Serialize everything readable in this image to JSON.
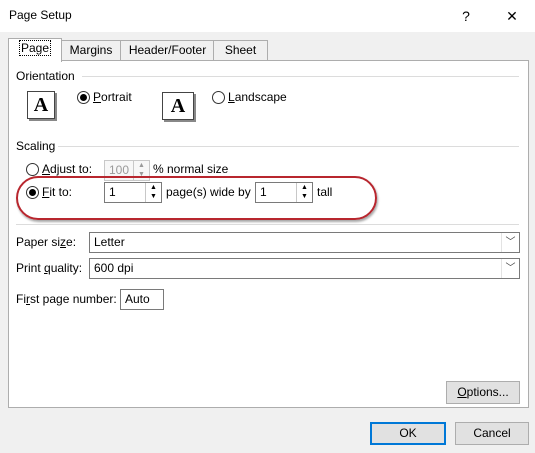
{
  "window": {
    "title": "Page Setup",
    "help_glyph": "?",
    "close_glyph": "✕"
  },
  "tabs": [
    {
      "label": "Page",
      "active": true
    },
    {
      "label": "Margins",
      "active": false
    },
    {
      "label": "Header/Footer",
      "active": false
    },
    {
      "label": "Sheet",
      "active": false
    }
  ],
  "orientation": {
    "group_label": "Orientation",
    "portrait_label": "Portrait",
    "landscape_label": "Landscape",
    "icon_letter": "A",
    "selected": "portrait"
  },
  "scaling": {
    "group_label": "Scaling",
    "adjust_label": "Adjust to:",
    "adjust_value": "100",
    "adjust_suffix": "% normal size",
    "fit_label": "Fit to:",
    "fit_wide_value": "1",
    "fit_wide_suffix": "page(s) wide by",
    "fit_tall_value": "1",
    "fit_tall_suffix": "tall",
    "selected": "fit",
    "highlight_color": "#b8262e"
  },
  "paper_size": {
    "label": "Paper size:",
    "value": "Letter"
  },
  "print_quality": {
    "label": "Print quality:",
    "value": "600 dpi"
  },
  "first_page": {
    "label": "First page number:",
    "value": "Auto"
  },
  "buttons": {
    "options": "Options...",
    "ok": "OK",
    "cancel": "Cancel"
  },
  "colors": {
    "accent": "#0078d7",
    "dialog_bg": "#f0f0f0"
  }
}
